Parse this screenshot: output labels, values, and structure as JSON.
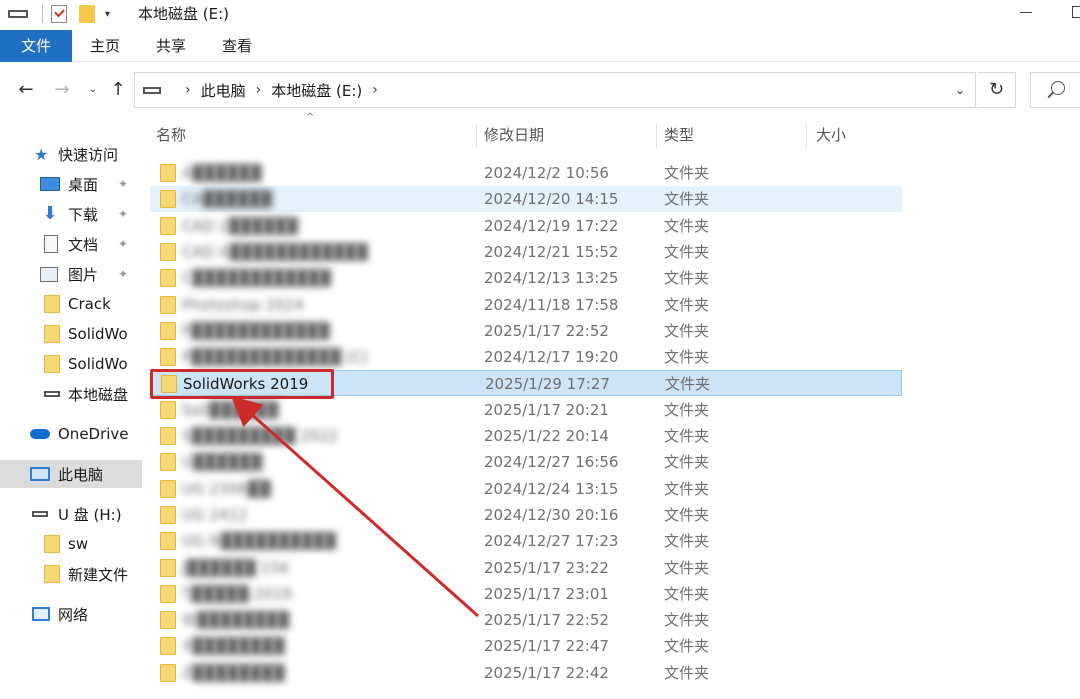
{
  "window": {
    "title": "本地磁盘 (E:)",
    "qat_arrow": "▾"
  },
  "ribbon": {
    "tabs": [
      "文件",
      "主页",
      "共享",
      "查看"
    ]
  },
  "nav": {
    "back": "←",
    "forward": "→",
    "recent": "⌄",
    "up": "↑",
    "breadcrumb": [
      "此电脑",
      "本地磁盘 (E:)"
    ],
    "crumb_separator": "›",
    "dropdown": "⌄",
    "refresh": "↻"
  },
  "sidebar": {
    "items": [
      {
        "label": "快速访问",
        "icon": "star-icon"
      },
      {
        "label": "桌面",
        "icon": "desktop-icon",
        "pinned": true
      },
      {
        "label": "下载",
        "icon": "download-icon",
        "pinned": true
      },
      {
        "label": "文档",
        "icon": "document-icon",
        "pinned": true
      },
      {
        "label": "图片",
        "icon": "picture-icon",
        "pinned": true
      },
      {
        "label": "Crack",
        "icon": "folder-icon"
      },
      {
        "label": "SolidWo",
        "icon": "folder-icon"
      },
      {
        "label": "SolidWo",
        "icon": "folder-icon"
      },
      {
        "label": "本地磁盘",
        "icon": "drive-icon"
      },
      {
        "label": "OneDrive",
        "icon": "cloud-icon"
      },
      {
        "label": "此电脑",
        "icon": "pc-icon",
        "selected": true
      },
      {
        "label": "U 盘 (H:)",
        "icon": "usb-drive-icon"
      },
      {
        "label": "sw",
        "icon": "folder-icon"
      },
      {
        "label": "新建文件",
        "icon": "folder-icon"
      },
      {
        "label": "网络",
        "icon": "network-icon"
      }
    ],
    "pin_glyph": "✦"
  },
  "columns": {
    "name": "名称",
    "modified": "修改日期",
    "type": "类型",
    "size": "大小",
    "sort_glyph": "^"
  },
  "files": [
    {
      "name": "A██████",
      "modified": "2024/12/2 10:56",
      "type": "文件夹",
      "blurred": true
    },
    {
      "name": "CA██████",
      "modified": "2024/12/20 14:15",
      "type": "文件夹",
      "blurred": true,
      "hover": true
    },
    {
      "name": "CAD 2██████",
      "modified": "2024/12/19 17:22",
      "type": "文件夹",
      "blurred": true
    },
    {
      "name": "CAD A████████████",
      "modified": "2024/12/21 15:52",
      "type": "文件夹",
      "blurred": true
    },
    {
      "name": "C████████████",
      "modified": "2024/12/13 13:25",
      "type": "文件夹",
      "blurred": true
    },
    {
      "name": "Photoshop 2024",
      "modified": "2024/11/18 17:58",
      "type": "文件夹",
      "blurred": true
    },
    {
      "name": "P████████████",
      "modified": "2025/1/17 22:52",
      "type": "文件夹",
      "blurred": true
    },
    {
      "name": "P█████████████ (C)",
      "modified": "2024/12/17 19:20",
      "type": "文件夹",
      "blurred": true
    },
    {
      "name": "SolidWorks 2019",
      "modified": "2025/1/29 17:27",
      "type": "文件夹",
      "blurred": false,
      "selected": true
    },
    {
      "name": "Soli██████",
      "modified": "2025/1/17 20:21",
      "type": "文件夹",
      "blurred": true
    },
    {
      "name": "S█████████ 2022",
      "modified": "2025/1/22 20:14",
      "type": "文件夹",
      "blurred": true
    },
    {
      "name": "U██████",
      "modified": "2024/12/27 16:56",
      "type": "文件夹",
      "blurred": true
    },
    {
      "name": "UG 2306██",
      "modified": "2024/12/24 13:15",
      "type": "文件夹",
      "blurred": true
    },
    {
      "name": "UG 2412",
      "modified": "2024/12/30 20:16",
      "type": "文件夹",
      "blurred": true
    },
    {
      "name": "UG N██████████",
      "modified": "2024/12/27 17:23",
      "type": "文件夹",
      "blurred": true
    },
    {
      "name": "J██████ 156",
      "modified": "2025/1/17 23:22",
      "type": "文件夹",
      "blurred": true
    },
    {
      "name": "T█████ 2019",
      "modified": "2025/1/17 23:01",
      "type": "文件夹",
      "blurred": true
    },
    {
      "name": "W████████",
      "modified": "2025/1/17 22:52",
      "type": "文件夹",
      "blurred": true
    },
    {
      "name": "X████████",
      "modified": "2025/1/17 22:47",
      "type": "文件夹",
      "blurred": true
    },
    {
      "name": "Z████████",
      "modified": "2025/1/17 22:42",
      "type": "文件夹",
      "blurred": true
    }
  ],
  "colors": {
    "accent": "#1f6fc2",
    "selection": "#cce4f7",
    "annotation": "#cf2a2a",
    "folder": "#f8d775"
  }
}
